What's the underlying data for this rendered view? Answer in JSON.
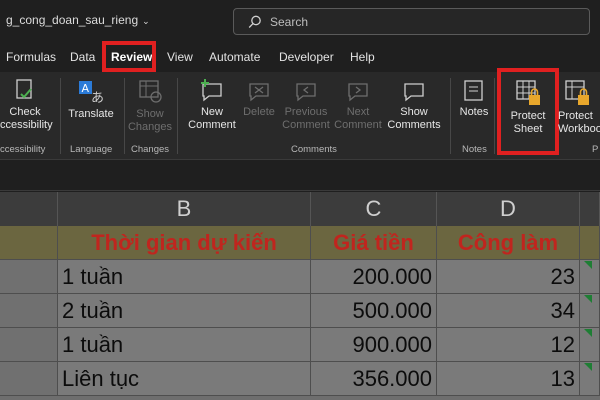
{
  "titlebar": {
    "filename": "g_cong_doan_sau_rieng"
  },
  "search": {
    "placeholder": "Search"
  },
  "tabs": [
    "Formulas",
    "Data",
    "Review",
    "View",
    "Automate",
    "Developer",
    "Help"
  ],
  "ribbon": {
    "check_accessibility": {
      "line1": "Check",
      "line2": "ccessibility"
    },
    "translate": "Translate",
    "show_changes": {
      "line1": "Show",
      "line2": "Changes"
    },
    "new_comment": {
      "line1": "New",
      "line2": "Comment"
    },
    "delete": "Delete",
    "previous_comment": {
      "line1": "Previous",
      "line2": "Comment"
    },
    "next_comment": {
      "line1": "Next",
      "line2": "Comment"
    },
    "show_comments": {
      "line1": "Show",
      "line2": "Comments"
    },
    "notes": "Notes",
    "protect_sheet": {
      "line1": "Protect",
      "line2": "Sheet"
    },
    "protect_workbook": {
      "line1": "Protect",
      "line2": "Workbook"
    },
    "groups": {
      "accessibility": "ccessibility",
      "language": "Language",
      "changes": "Changes",
      "comments": "Comments",
      "notes": "Notes",
      "protect": "P"
    }
  },
  "sheet": {
    "columns": [
      "B",
      "C",
      "D"
    ],
    "header_row": [
      "Thời gian dự kiến",
      "Giá tiền",
      "Công làm"
    ],
    "rows": [
      [
        "1 tuần",
        "200.000",
        "23"
      ],
      [
        "2 tuần",
        "500.000",
        "34"
      ],
      [
        "1 tuần",
        "900.000",
        "12"
      ],
      [
        "Liên tục",
        "356.000",
        "13"
      ]
    ]
  },
  "colors": {
    "highlight": "#e02020",
    "header_text": "#c0251e",
    "accent": "#66bb6a"
  }
}
